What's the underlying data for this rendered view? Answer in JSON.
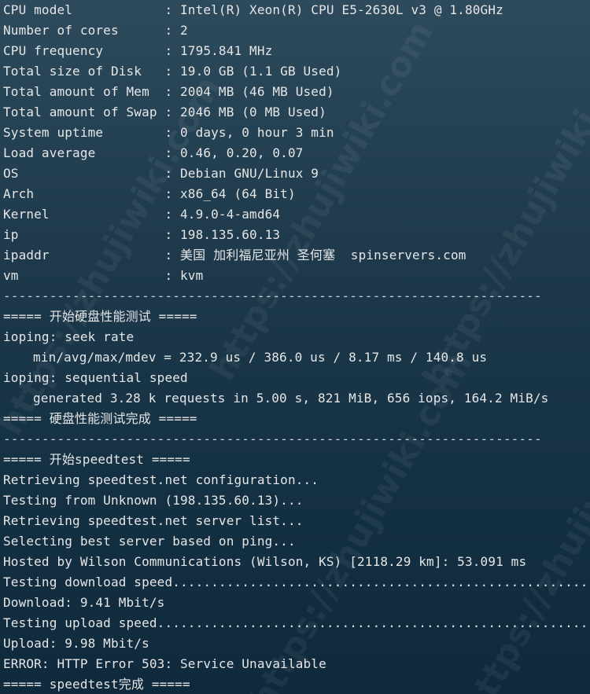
{
  "terminal": {
    "sysinfo": [
      "CPU model            : Intel(R) Xeon(R) CPU E5-2630L v3 @ 1.80GHz",
      "Number of cores      : 2",
      "CPU frequency        : 1795.841 MHz",
      "Total size of Disk   : 19.0 GB (1.1 GB Used)",
      "Total amount of Mem  : 2004 MB (46 MB Used)",
      "Total amount of Swap : 2046 MB (0 MB Used)",
      "System uptime        : 0 days, 0 hour 3 min",
      "Load average         : 0.46, 0.20, 0.07",
      "OS                   : Debian GNU/Linux 9",
      "Arch                 : x86_64 (64 Bit)",
      "Kernel               : 4.9.0-4-amd64",
      "ip                   : 198.135.60.13",
      "ipaddr               : 美国 加利福尼亚州 圣何塞  spinservers.com",
      "vm                   : kvm"
    ],
    "separator": "----------------------------------------------------------------------",
    "disk_test": {
      "start": "===== 开始硬盘性能测试 =====",
      "seek_label": "ioping: seek rate",
      "seek_result": "min/avg/max/mdev = 232.9 us / 386.0 us / 8.17 ms / 140.8 us",
      "seq_label": "ioping: sequential speed",
      "seq_result": "generated 3.28 k requests in 5.00 s, 821 MiB, 656 iops, 164.2 MiB/s",
      "end": "===== 硬盘性能测试完成 ====="
    },
    "speedtest": {
      "start": "===== 开始speedtest =====",
      "lines": [
        "Retrieving speedtest.net configuration...",
        "Testing from Unknown (198.135.60.13)...",
        "Retrieving speedtest.net server list...",
        "Selecting best server based on ping...",
        "Hosted by Wilson Communications (Wilson, KS) [2118.29 km]: 53.091 ms",
        "Testing download speed................................................................................",
        "Download: 9.41 Mbit/s",
        "Testing upload speed................................................................................",
        "Upload: 9.98 Mbit/s",
        "ERROR: HTTP Error 503: Service Unavailable"
      ],
      "end": "===== speedtest完成 ====="
    }
  },
  "watermark": "https://zhujiwiki.com"
}
